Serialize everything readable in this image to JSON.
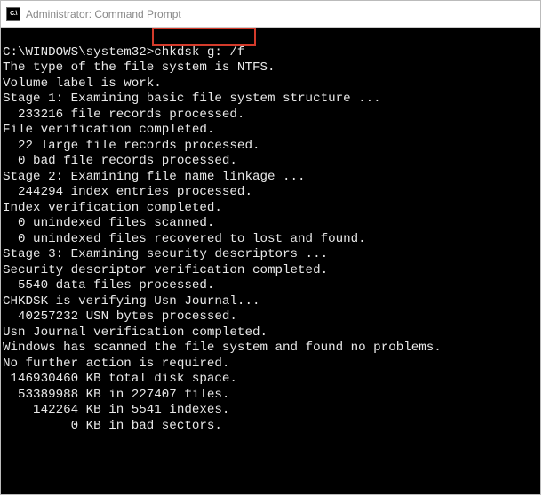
{
  "titlebar": {
    "icon_label": "C:\\",
    "title": "Administrator: Command Prompt"
  },
  "terminal": {
    "prompt": "C:\\WINDOWS\\system32>",
    "command": "chkdsk g: /f",
    "lines": [
      "The type of the file system is NTFS.",
      "Volume label is work.",
      "",
      "Stage 1: Examining basic file system structure ...",
      "  233216 file records processed.",
      "File verification completed.",
      "  22 large file records processed.",
      "  0 bad file records processed.",
      "",
      "Stage 2: Examining file name linkage ...",
      "  244294 index entries processed.",
      "Index verification completed.",
      "  0 unindexed files scanned.",
      "  0 unindexed files recovered to lost and found.",
      "",
      "Stage 3: Examining security descriptors ...",
      "Security descriptor verification completed.",
      "  5540 data files processed.",
      "CHKDSK is verifying Usn Journal...",
      "  40257232 USN bytes processed.",
      "Usn Journal verification completed.",
      "",
      "Windows has scanned the file system and found no problems.",
      "No further action is required.",
      "",
      " 146930460 KB total disk space.",
      "  53389988 KB in 227407 files.",
      "    142264 KB in 5541 indexes.",
      "         0 KB in bad sectors."
    ]
  }
}
